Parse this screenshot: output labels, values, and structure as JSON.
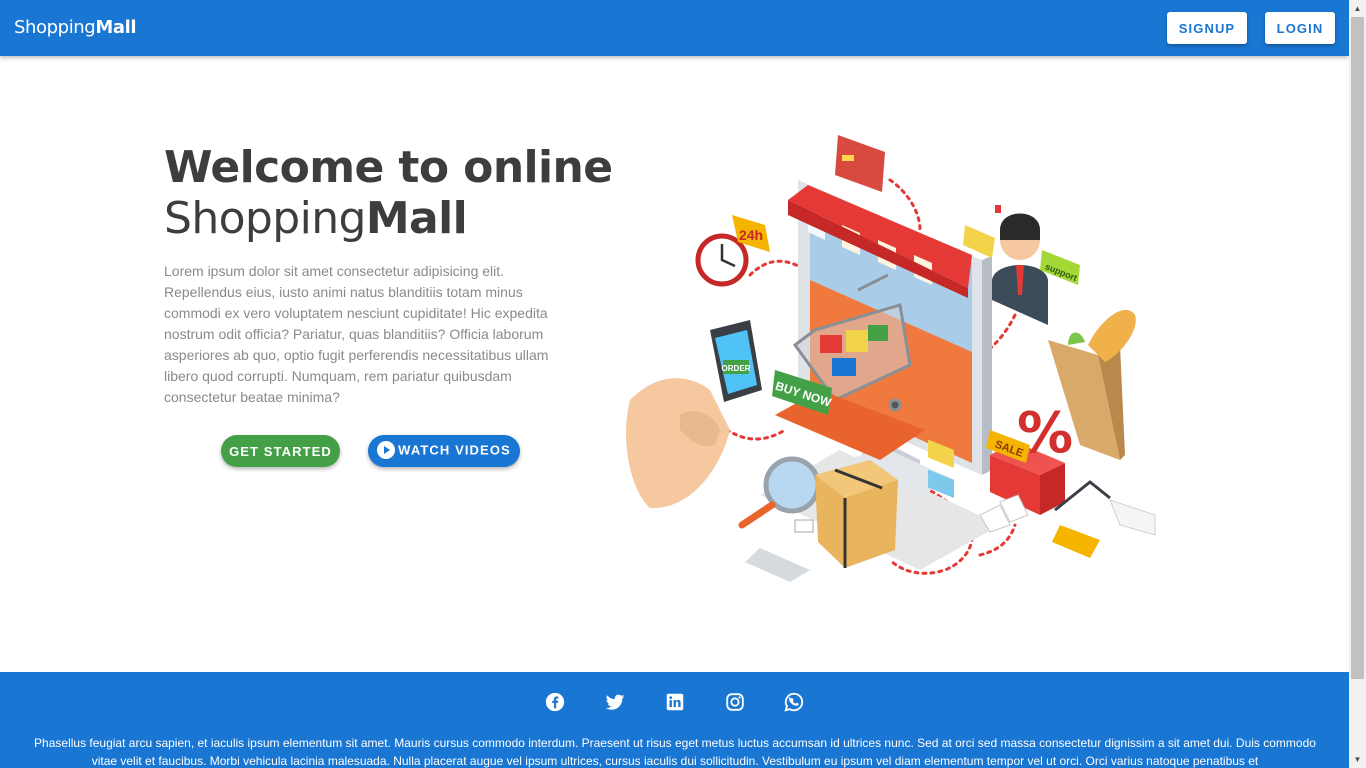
{
  "header": {
    "brand_light": "Shopping",
    "brand_bold": "Mall",
    "signup_label": "SIGNUP",
    "login_label": "LOGIN",
    "color": "#1976d2"
  },
  "hero": {
    "title_line1": "Welcome to online",
    "title_line2_light": "Shopping",
    "title_line2_bold": "Mall",
    "description": "Lorem ipsum dolor sit amet consectetur adipisicing elit. Repellendus eius, iusto animi natus blanditiis totam minus commodi ex vero voluptatem nesciunt cupiditate! Hic expedita nostrum odit officia? Pariatur, quas blanditiis? Officia laborum asperiores ab quo, optio fugit perferendis necessitatibus ullam libero quod corrupti. Numquam, rem pariatur quibusdam consectetur beatae minima?",
    "get_started_label": "GET STARTED",
    "watch_videos_label": "WATCH VIDEOS",
    "get_started_color": "#43a047",
    "watch_videos_color": "#1976d2"
  },
  "illustration": {
    "bubble_24h": "24h",
    "sign_buy_now": "BUY NOW",
    "phone_order": "ORDER",
    "badge_support": "support",
    "tag_sale": "SALE",
    "percent_sign": "%"
  },
  "footer": {
    "social_icons": [
      "facebook-icon",
      "twitter-icon",
      "linkedin-icon",
      "instagram-icon",
      "whatsapp-icon"
    ],
    "text": "Phasellus feugiat arcu sapien, et iaculis ipsum elementum sit amet. Mauris cursus commodo interdum. Praesent ut risus eget metus luctus accumsan id ultrices nunc. Sed at orci sed massa consectetur dignissim a sit amet dui. Duis commodo vitae velit et faucibus. Morbi vehicula lacinia malesuada. Nulla placerat augue vel ipsum ultrices, cursus iaculis dui sollicitudin. Vestibulum eu ipsum vel diam elementum tempor vel ut orci. Orci varius natoque penatibus et"
  }
}
